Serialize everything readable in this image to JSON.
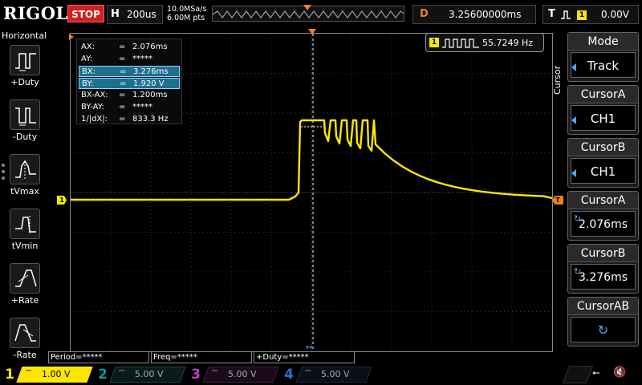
{
  "header": {
    "brand": "RIGOL",
    "run_state": "STOP",
    "timebase_label": "H",
    "timebase_value": "200us",
    "sample_rate": "10.0MSa/s",
    "memory_depth": "6.00M pts",
    "delay_label": "D",
    "delay_value": "3.25600000ms",
    "trigger_label": "T",
    "trigger_channel": "1",
    "trigger_level": "0.00V"
  },
  "left_panel": {
    "title": "Horizontal",
    "items": [
      {
        "label": "+Duty",
        "icon": "positive-duty-icon"
      },
      {
        "label": "-Duty",
        "icon": "negative-duty-icon"
      },
      {
        "label": "tVmax",
        "icon": "time-at-vmax-icon"
      },
      {
        "label": "tVmin",
        "icon": "time-at-vmin-icon"
      },
      {
        "label": "+Rate",
        "icon": "rise-rate-icon"
      },
      {
        "label": "-Rate",
        "icon": "fall-rate-icon"
      }
    ]
  },
  "cursor_readout": {
    "rows": [
      {
        "key": "AX:",
        "value": "2.076ms",
        "highlight": false
      },
      {
        "key": "AY:",
        "value": "*****",
        "highlight": false
      },
      {
        "key": "BX:",
        "value": "3.276ms",
        "highlight": true
      },
      {
        "key": "BY:",
        "value": "1.920 V",
        "highlight": true
      },
      {
        "key": "BX-AX:",
        "value": "1.200ms",
        "highlight": false
      },
      {
        "key": "BY-AY:",
        "value": "*****",
        "highlight": false
      },
      {
        "key": "1/|dX|:",
        "value": "833.3 Hz",
        "highlight": false
      }
    ],
    "eq": "="
  },
  "frequency_counter": {
    "channel": "1",
    "value": "55.7249 Hz"
  },
  "markers": {
    "channel_marker": "1",
    "trigger_level_marker": "T"
  },
  "right_menu": {
    "vertical_label": "Cursor",
    "items": [
      {
        "title": "Mode",
        "value": "Track"
      },
      {
        "title": "CursorA",
        "value": "CH1"
      },
      {
        "title": "CursorB",
        "value": "CH1"
      },
      {
        "title": "CursorA",
        "value": "2.076ms"
      },
      {
        "title": "CursorB",
        "value": "3.276ms"
      },
      {
        "title": "CursorAB",
        "value": ""
      }
    ]
  },
  "measurements": {
    "period": "Period=*****",
    "freq": "Freq=*****",
    "duty": "+Duty=*****"
  },
  "channels": [
    {
      "num": "1",
      "value": "1.00 V",
      "color": "#ffe600"
    },
    {
      "num": "2",
      "value": "5.00 V",
      "color": "#00c8c8"
    },
    {
      "num": "3",
      "value": "5.00 V",
      "color": "#ff40ff"
    },
    {
      "num": "4",
      "value": "5.00 V",
      "color": "#3080ff"
    }
  ],
  "colors": {
    "trace": "#ffe600",
    "trigger": "#f08020",
    "accent": "#4aa8ff",
    "stop": "#d02020"
  }
}
